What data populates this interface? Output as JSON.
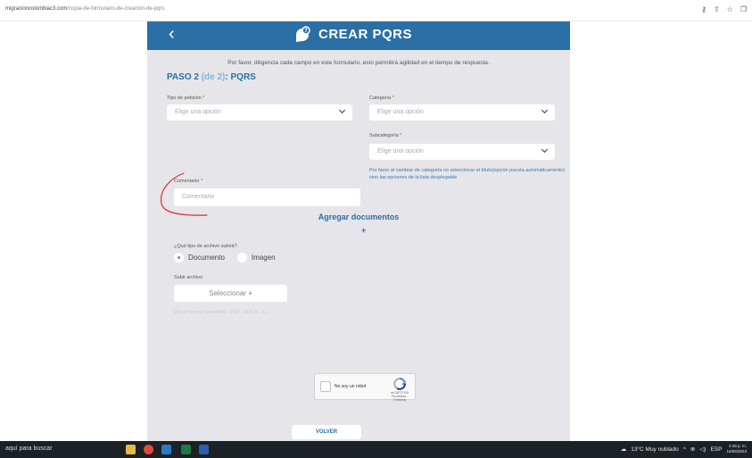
{
  "browser": {
    "url_domain": "migracioncolombiac3.com",
    "url_path": "/copia-de-formulario-de-creación-de-pqrs"
  },
  "header": {
    "back_icon": "chevron-left-icon",
    "title": "CREAR PQRS"
  },
  "form": {
    "intro": "Por favor, diligencia cada campo en este formulario, esto permitirá agilidad en el tiempo de respuesta.",
    "step_prefix": "PASO 2",
    "step_count": "(de 2)",
    "step_suffix": ": PQRS",
    "tipo_label": "Tipo de petición",
    "tipo_placeholder": "Elige una opción",
    "categoria_label": "Categoría",
    "categoria_placeholder": "Elige una opción",
    "subcategoria_label": "Subcategoría",
    "subcategoria_placeholder": "Elige una opción",
    "note": "Por favor al cambiar de categoría no seleccionar el título(opción puesta automáticamente) sino las opciones de la lista desplegable",
    "comentario_label": "Comentario",
    "comentario_placeholder": "Comentario",
    "required_mark": "*"
  },
  "documents": {
    "title": "Agregar documentos",
    "add": "+",
    "question": "¿Qué tipo de archivo subirá?",
    "options": [
      "Documento",
      "Imagen"
    ],
    "selected": "Documento",
    "upload_label": "Subir archivo",
    "upload_button": "Seleccionar",
    "upload_plus": "+",
    "formats": "Único formato permitido: .PDF, .DOCX, .X..."
  },
  "captcha": {
    "label": "No soy un robot",
    "brand": "reCAPTCHA",
    "links": "Privacidad - Términos"
  },
  "footer": {
    "back_button": "VOLVER"
  },
  "taskbar": {
    "search": "aquí para buscar",
    "weather": "13°C  Muy nublado",
    "lang": "ESP",
    "time": "2:49 p. m.",
    "date": "16/06/2023"
  },
  "colors": {
    "brand_blue": "#2a6fa6",
    "panel_gray": "#e6e5e9",
    "annotation_red": "#d93030"
  }
}
